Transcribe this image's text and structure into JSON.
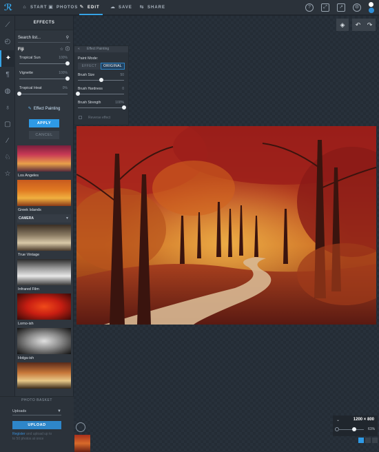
{
  "nav": {
    "logo_icon": "p-logo-icon",
    "items": [
      {
        "label": "START",
        "icon": "home-icon"
      },
      {
        "label": "PHOTOS",
        "icon": "photos-icon"
      },
      {
        "label": "EDIT",
        "icon": "wand-icon"
      },
      {
        "label": "SAVE",
        "icon": "cloud-icon"
      },
      {
        "label": "SHARE",
        "icon": "share-icon"
      }
    ],
    "active": "EDIT",
    "right_icons": [
      "help-icon",
      "fullscreen-icon",
      "expand-icon",
      "settings-icon",
      "user-icon"
    ]
  },
  "tools": [
    "crop-icon",
    "adjust-icon",
    "effects-icon",
    "text-icon",
    "retouch-icon",
    "stamp-icon",
    "frame-icon",
    "draw-icon",
    "overlay-icon",
    "favorites-icon"
  ],
  "effects_panel": {
    "title": "EFFECTS",
    "search_placeholder": "Search list...",
    "effect_name": "Fiji",
    "sliders": [
      {
        "label": "Tropical Sun",
        "value": "100%",
        "fraction": 1.0
      },
      {
        "label": "Vignette",
        "value": "100%",
        "fraction": 1.0
      },
      {
        "label": "Tropical Heat",
        "value": "0%",
        "fraction": 0.0
      }
    ],
    "effect_painting_label": "Effect Painting",
    "apply_label": "APPLY",
    "cancel_label": "CANCEL",
    "thumbnails": [
      {
        "label": "Los Angeles",
        "style": "a"
      },
      {
        "label": "Greek Islands",
        "style": "b"
      }
    ],
    "group_header": "CAMERA",
    "camera_thumbnails": [
      {
        "label": "True Vintage",
        "style": "c"
      },
      {
        "label": "Infrared Film",
        "style": "d"
      },
      {
        "label": "Lomo-ish",
        "style": "e"
      },
      {
        "label": "Holga-ish",
        "style": "f"
      },
      {
        "label": "",
        "style": "g"
      }
    ]
  },
  "effect_painting": {
    "header": "Effect Painting",
    "paint_mode_label": "Paint Mode:",
    "mode_effect": "EFFECT",
    "mode_original": "ORIGINAL",
    "active_mode": "ORIGINAL",
    "sliders": [
      {
        "label": "Brush Size",
        "value": "50",
        "fraction": 0.5
      },
      {
        "label": "Brush Hardness",
        "value": "0",
        "fraction": 0.0
      },
      {
        "label": "Brush Strength",
        "value": "100%",
        "fraction": 1.0
      }
    ],
    "reverse_label": "Reverse effect"
  },
  "photo_basket": {
    "title": "PHOTO BASKET",
    "select_value": "Uploads",
    "upload_label": "UPLOAD",
    "note_link": "Register",
    "note_text": " and upload up to",
    "note_text2": "to 50 photos at once"
  },
  "zoom": {
    "dimensions": "1200 × 800",
    "percent": "61%",
    "fraction": 0.61
  },
  "colors": {
    "accent": "#2e9ae6",
    "background": "#1f262e"
  }
}
